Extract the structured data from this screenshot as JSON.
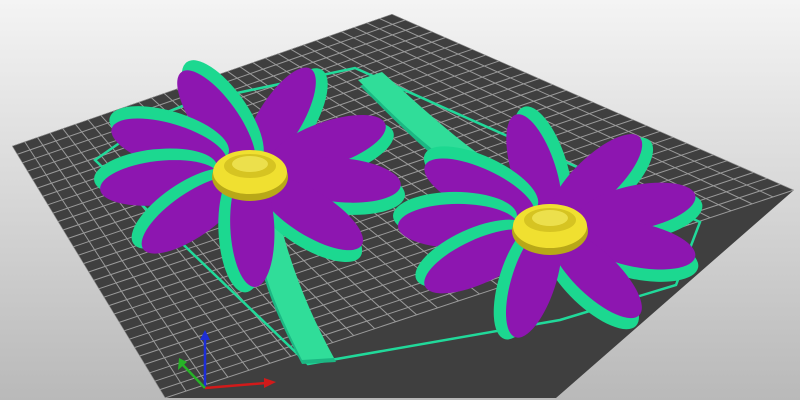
{
  "viewport": {
    "background_top": "#f4f4f4",
    "background_bottom": "#b9b9b9"
  },
  "print_bed": {
    "fill": "#3f3f3f",
    "grid_line": "#9a9a9a"
  },
  "skirt": {
    "color": "#21d99a"
  },
  "flowers": [
    {
      "id": "flower-left",
      "petal_color": "#8d16b0",
      "petal_edge_color": "#1cd890",
      "center_color": "#f0e030",
      "stem_color": "#30dd99",
      "petal_count": 9
    },
    {
      "id": "flower-right",
      "petal_color": "#8d16b0",
      "petal_edge_color": "#1cd890",
      "center_color": "#f0e030",
      "stem_color": "#30dd99",
      "petal_count": 9
    }
  ],
  "axes": {
    "x_color": "#d21a1a",
    "y_color": "#27b327",
    "z_color": "#1d2ed8"
  },
  "icons": {
    "axis_gizmo": "xyz-axes-icon"
  }
}
